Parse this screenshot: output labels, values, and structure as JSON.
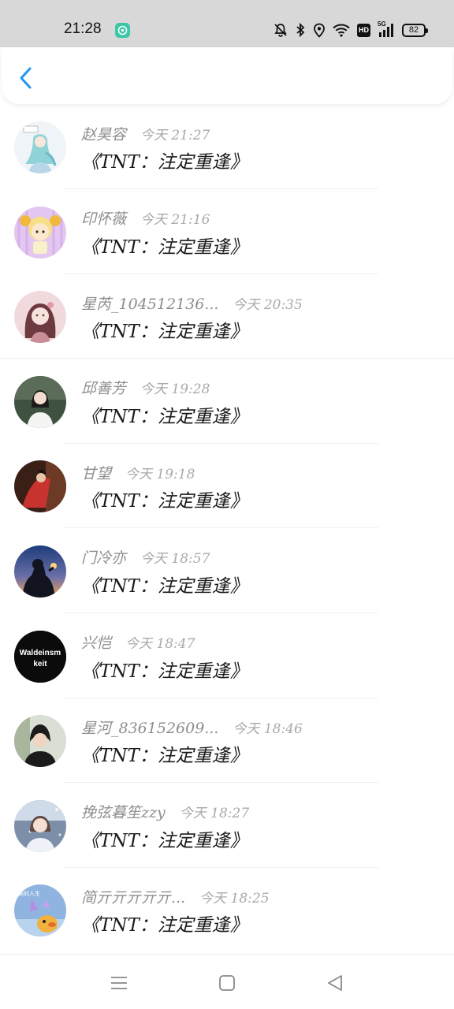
{
  "status_bar": {
    "time": "21:28",
    "battery_level": "82",
    "hd_label": "HD",
    "network_label": "5G",
    "icons": [
      "chat-app-icon",
      "mute-bell-icon",
      "bluetooth-icon",
      "location-icon",
      "wifi-icon",
      "hd-icon",
      "signal-5g-icon",
      "battery-icon"
    ]
  },
  "header": {
    "back_icon": "chevron-left-icon",
    "accent_color": "#2196f3"
  },
  "items": [
    {
      "name": "赵昊容",
      "time": "今天 21:27",
      "message": "《TNT：注定重逢》",
      "avatar": "anime-girl-teal"
    },
    {
      "name": "印怀薇",
      "time": "今天 21:16",
      "message": "《TNT：注定重逢》",
      "avatar": "cartoon-aries-girl"
    },
    {
      "name": "星芮_104512136...",
      "time": "今天 20:35",
      "message": "《TNT：注定重逢》",
      "avatar": "illustrated-girl-pink"
    },
    {
      "name": "邱善芳",
      "time": "今天 19:28",
      "message": "《TNT：注定重逢》",
      "avatar": "photo-person-white-shirt"
    },
    {
      "name": "甘望",
      "time": "今天 19:18",
      "message": "《TNT：注定重逢》",
      "avatar": "photo-person-red-dress"
    },
    {
      "name": "门冷亦",
      "time": "今天 18:57",
      "message": "《TNT：注定重逢》",
      "avatar": "silhouette-lantern-sunset"
    },
    {
      "name": "兴恺",
      "time": "今天 18:47",
      "message": "《TNT：注定重逢》",
      "avatar": "text-logo",
      "avatar_text": [
        "Waldeinsm",
        "keit"
      ]
    },
    {
      "name": "星河_836152609...",
      "time": "今天 18:46",
      "message": "《TNT：注定重逢》",
      "avatar": "photo-young-man"
    },
    {
      "name": "挽弦暮笙zzy",
      "time": "今天 18:27",
      "message": "《TNT：注定重逢》",
      "avatar": "photo-girl-snow"
    },
    {
      "name": "简亓亓亓亓亓...",
      "time": "今天 18:25",
      "message": "《TNT：注定重逢》",
      "avatar": "cartoon-duck-sky",
      "avatar_text": [
        "美的人生"
      ]
    }
  ],
  "nav": {
    "icons": [
      "menu-icon",
      "home-square-icon",
      "back-triangle-icon"
    ]
  }
}
